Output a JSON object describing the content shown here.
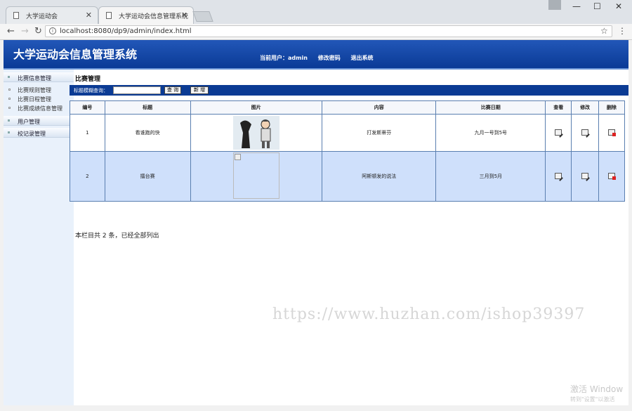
{
  "browser": {
    "tabs": [
      {
        "title": "大学运动会"
      },
      {
        "title": "大学运动会信息管理系统"
      }
    ],
    "url": "localhost:8080/dp9/admin/index.html"
  },
  "header": {
    "app_title": "大学运动会信息管理系统",
    "current_user_label": "当前用户：admin",
    "change_password": "修改密码",
    "logout": "退出系统"
  },
  "sidebar": {
    "groups": [
      {
        "label": "比赛信息管理"
      },
      {
        "label": "用户管理"
      },
      {
        "label": "校记录管理"
      }
    ],
    "items": [
      {
        "label": "比赛规则管理"
      },
      {
        "label": "比赛日程管理"
      },
      {
        "label": "比赛成绩信息管理"
      }
    ]
  },
  "content": {
    "title": "比赛管理",
    "search_label": "标题模糊查询：",
    "search_value": "",
    "search_button": "查 询",
    "add_button": "新 增",
    "columns": [
      "编号",
      "标题",
      "图片",
      "内容",
      "比赛日期",
      "查看",
      "修改",
      "删除"
    ],
    "rows": [
      {
        "id": "1",
        "title": "看谁跑的快",
        "content": "打发斯蒂芬",
        "date": "九月一号到5号"
      },
      {
        "id": "2",
        "title": "擂台赛",
        "content": "阿斯顿发的说法",
        "date": "三月到5月"
      }
    ],
    "summary": "本栏目共 2 条，已经全部列出"
  },
  "watermark": "https://www.huzhan.com/ishop39397",
  "windows_activation": {
    "line1": "激活 Window",
    "line2": "转到\"设置\"以激活"
  },
  "colors": {
    "header_blue": "#0a3a96",
    "search_bar": "#0b3b94",
    "row_highlight": "#cfe0fb"
  }
}
